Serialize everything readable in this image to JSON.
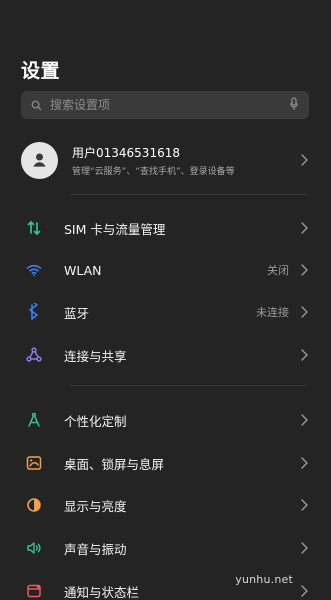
{
  "page": {
    "title": "设置"
  },
  "search": {
    "placeholder": "搜索设置项"
  },
  "profile": {
    "name": "用户01346531618",
    "subtitle": "管理“云服务”、“查找手机”、登录设备等"
  },
  "rows": [
    {
      "label": "SIM 卡与流量管理",
      "value": ""
    },
    {
      "label": "WLAN",
      "value": "关闭"
    },
    {
      "label": "蓝牙",
      "value": "未连接"
    },
    {
      "label": "连接与共享",
      "value": ""
    },
    {
      "label": "个性化定制",
      "value": ""
    },
    {
      "label": "桌面、锁屏与息屏",
      "value": ""
    },
    {
      "label": "显示与亮度",
      "value": ""
    },
    {
      "label": "声音与振动",
      "value": ""
    },
    {
      "label": "通知与状态栏",
      "value": ""
    }
  ],
  "watermark": "yunhu.net",
  "icons": {
    "search": "search-icon",
    "mic": "microphone-icon",
    "avatar": "user-avatar-icon",
    "sim": "sim-data-icon",
    "wlan": "wifi-icon",
    "bluetooth": "bluetooth-icon",
    "connection": "connection-share-icon",
    "personalize": "personalize-icon",
    "desktop": "desktop-lock-icon",
    "display": "display-brightness-icon",
    "sound": "sound-vibration-icon",
    "notification": "notification-status-bar-icon",
    "chevron": "chevron-right-icon"
  },
  "colors": {
    "background": "#242424",
    "search_bg": "#3a3a3a",
    "text_primary": "#ffffff",
    "text_secondary": "#9b9b9b",
    "green": "#35c38c",
    "blue": "#3b7df1",
    "purple": "#8f78e8",
    "orange": "#f2a04d",
    "red": "#ea5b64"
  }
}
